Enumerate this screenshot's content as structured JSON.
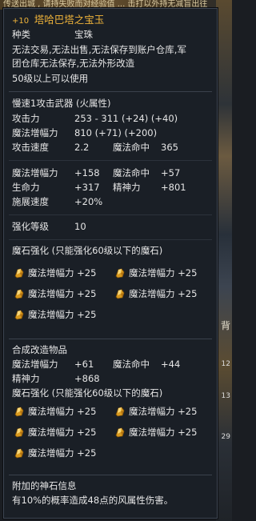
{
  "background": {
    "top_text": "传送出城 , 请持失败而对经验值 ... 击打以外持无减盲出往",
    "side_label": "背",
    "side_numbers": [
      "12",
      "13",
      "29"
    ]
  },
  "item": {
    "plus": "+10",
    "name": "塔哈巴塔之宝玉",
    "type_label": "种类",
    "type_value": "宝珠",
    "restriction_line1": "无法交易,无法出售,无法保存到账户仓库,军",
    "restriction_line2": "团仓库无法保存,无法外形改造",
    "level_req": "50级以上可以使用",
    "weapon_type": "慢速1攻击武器 (火属性)",
    "stats": {
      "attack_label": "攻击力",
      "attack_value": "253 - 311 (+24) (+40)",
      "magic_boost_label": "魔法增幅力",
      "magic_boost_value": "810 (+71) (+200)",
      "attack_speed_label": "攻击速度",
      "attack_speed_value": "2.2",
      "magic_acc_label": "魔法命中",
      "magic_acc_value": "365"
    },
    "bonus": {
      "magic_boost_label": "魔法增幅力",
      "magic_boost_value": "+158",
      "magic_acc_label": "魔法命中",
      "magic_acc_value": "+57",
      "hp_label": "生命力",
      "hp_value": "+317",
      "mp_label": "精神力",
      "mp_value": "+801",
      "cast_label": "施展速度",
      "cast_value": "+20%"
    },
    "enchant_label": "强化等级",
    "enchant_value": "10",
    "manastone_header": "魔石强化 (只能强化60级以下的魔石)",
    "manastones": [
      "魔法增幅力 +25",
      "魔法增幅力 +25",
      "魔法增幅力 +25",
      "魔法增幅力 +25",
      "魔法增幅力 +25"
    ],
    "fusion_header": "合成改造物品",
    "fusion": {
      "magic_boost_label": "魔法增幅力",
      "magic_boost_value": "+61",
      "magic_acc_label": "魔法命中",
      "magic_acc_value": "+44",
      "mp_label": "精神力",
      "mp_value": "+868"
    },
    "fusion_manastone_header": "魔石强化 (只能强化60级以下的魔石)",
    "fusion_manastones": [
      "魔法增幅力 +25",
      "魔法增幅力 +25",
      "魔法增幅力 +25",
      "魔法增幅力 +25",
      "魔法增幅力 +25"
    ],
    "godstone_header": "附加的神石信息",
    "godstone_desc": "有10%的概率造成48点的风属性伤害。"
  },
  "colors": {
    "accent_gold": "#f0b43a",
    "text_white": "#e6e6e6",
    "panel_bg": "#1b1f26"
  },
  "icons": {
    "manastone": "gold-manastone-icon"
  }
}
